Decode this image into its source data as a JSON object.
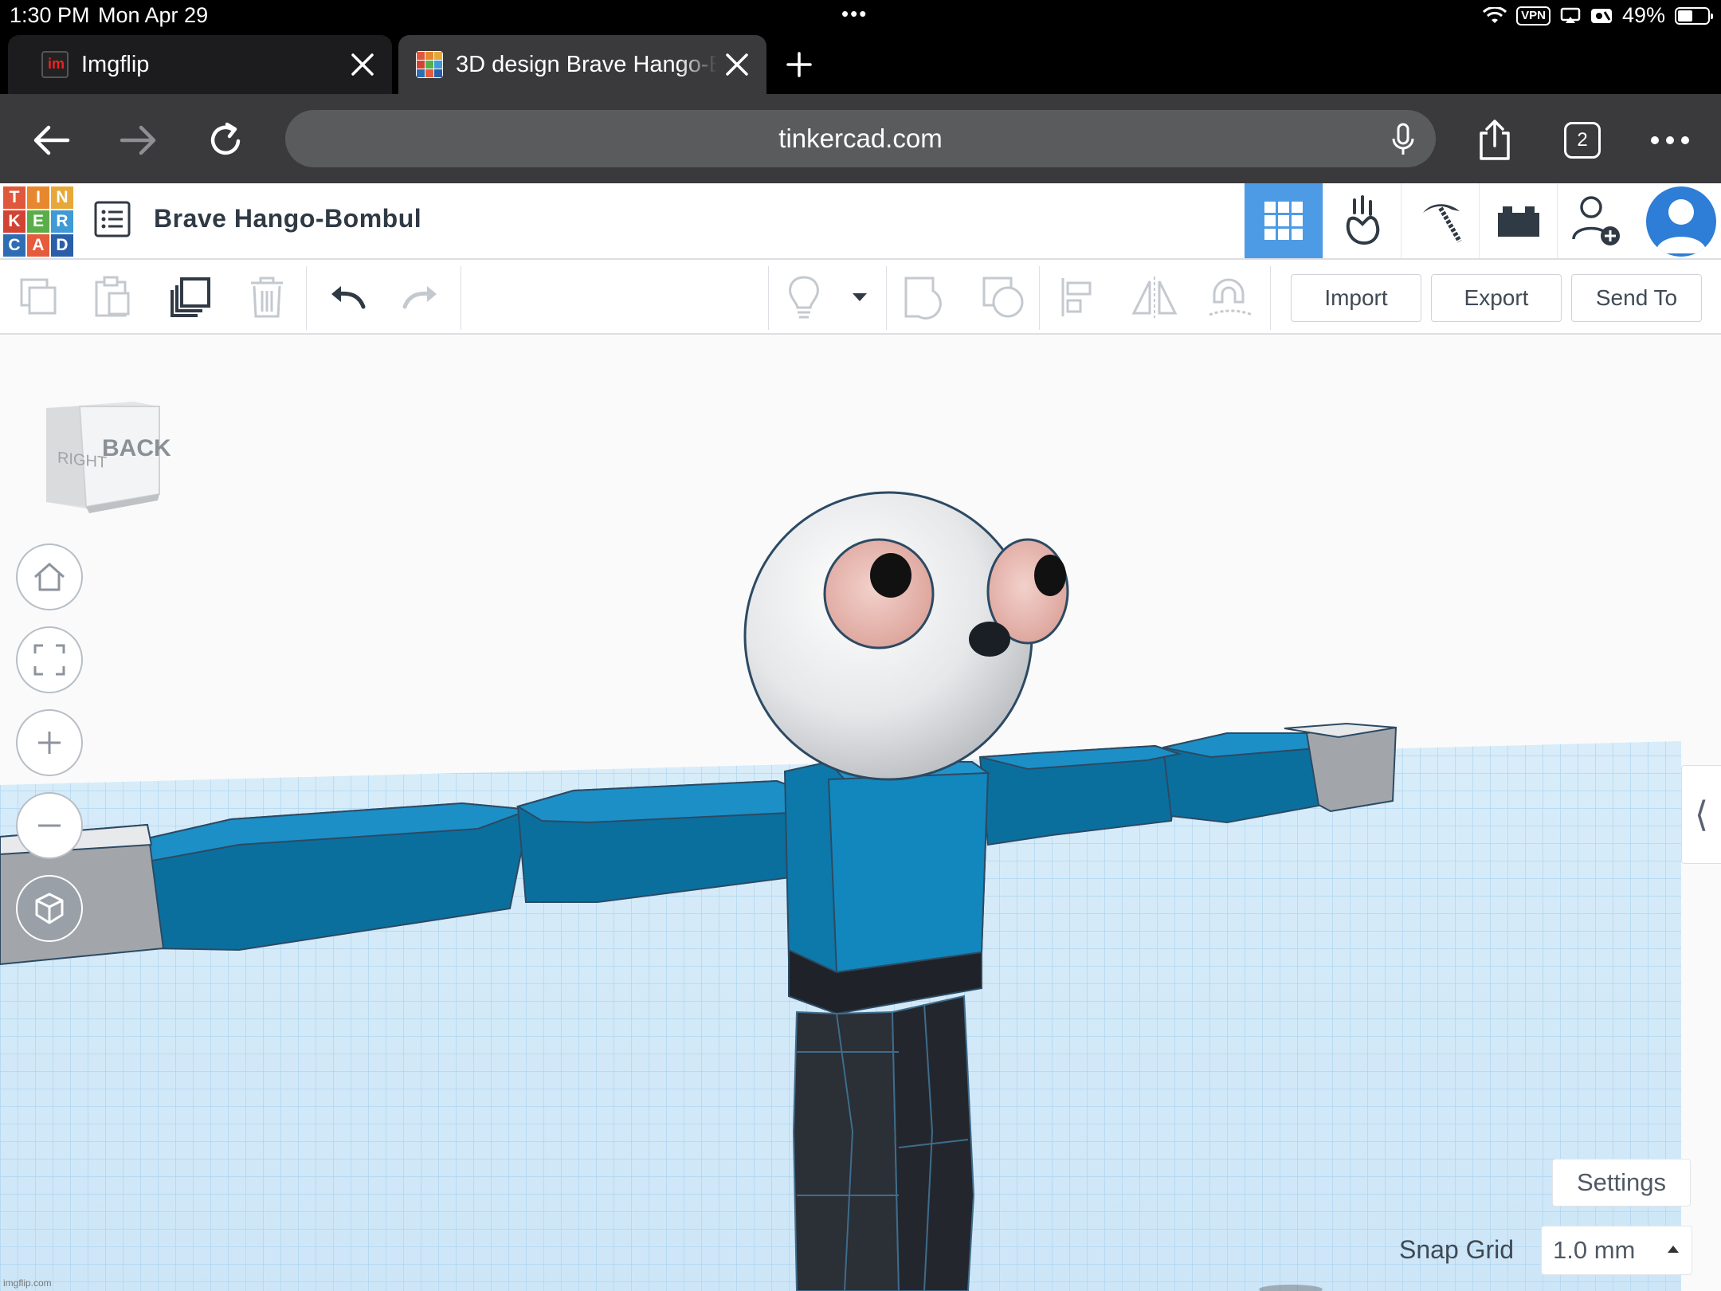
{
  "status_bar": {
    "time": "1:30 PM",
    "date": "Mon Apr 29",
    "vpn": "VPN",
    "battery": "49%"
  },
  "tabs": [
    {
      "label": "Imgflip",
      "icon": "imgflip-favicon"
    },
    {
      "label": "3D design Brave Hango-Bombul",
      "icon": "tinkercad-favicon"
    }
  ],
  "nav": {
    "url": "tinkercad.com",
    "tab_count": "2"
  },
  "tinkercad": {
    "logo_letters": [
      "T",
      "I",
      "N",
      "K",
      "E",
      "R",
      "C",
      "A",
      "D"
    ],
    "logo_colors": [
      "#e0583c",
      "#e7882e",
      "#e7a83a",
      "#d14434",
      "#5aae4a",
      "#3f9ad6",
      "#2f6db3",
      "#e55b3b",
      "#2a5ea8"
    ],
    "design_title": "Brave Hango-Bombul",
    "header_icons": [
      "grid-view-icon",
      "tinker-hand-icon",
      "pickaxe-icon",
      "bricks-icon",
      "add-user-icon",
      "avatar-icon"
    ],
    "accent_color": "#4d9be4"
  },
  "toolbar": {
    "import_label": "Import",
    "export_label": "Export",
    "send_to_label": "Send To"
  },
  "viewport": {
    "viewcube_face_front": "BACK",
    "viewcube_face_side": "RIGHT",
    "settings_label": "Settings",
    "snap_grid_label": "Snap Grid",
    "snap_grid_value": "1.0 mm",
    "collapse_glyph": "⟨",
    "watermark": "imgflip.com"
  }
}
